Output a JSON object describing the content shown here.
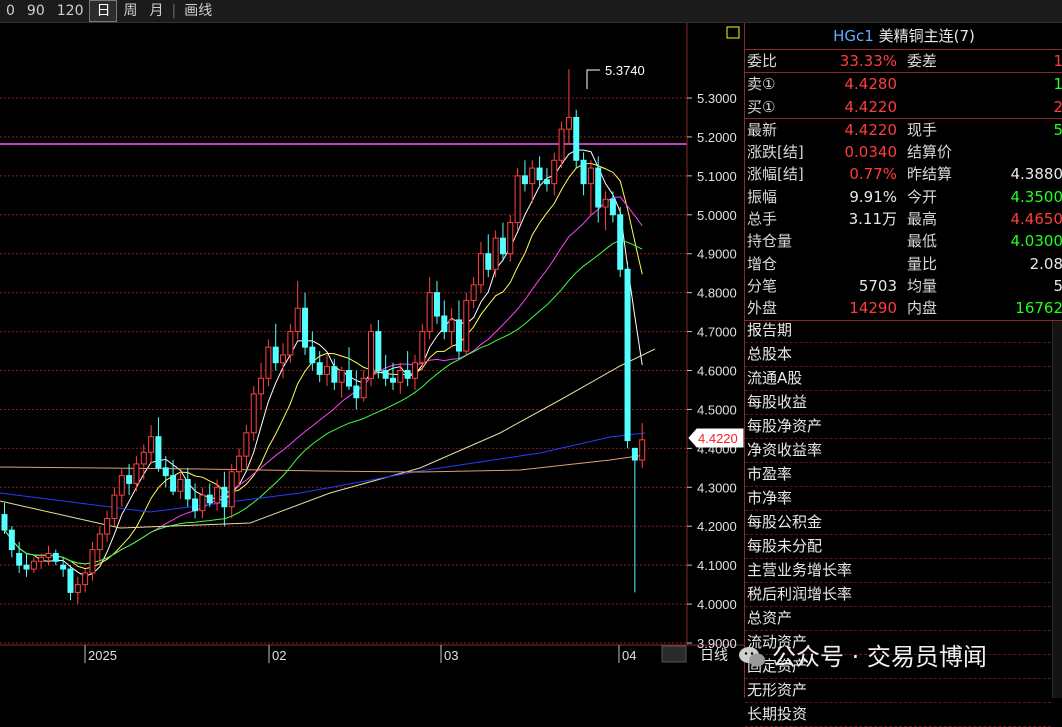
{
  "toolbar": {
    "items": [
      "0",
      "90",
      "120",
      "日",
      "周",
      "月",
      "画线"
    ],
    "active": "日"
  },
  "chart": {
    "price_labels": [
      "5.3000",
      "5.2000",
      "5.1000",
      "5.0000",
      "4.9000",
      "4.8000",
      "4.7000",
      "4.6000",
      "4.5000",
      "4.4000",
      "4.3000",
      "4.2000",
      "4.1000",
      "4.0000",
      "3.9000"
    ],
    "date_labels": [
      "2025",
      "02",
      "03",
      "04"
    ],
    "high_annotation": "5.3740",
    "current_price": "4.4220",
    "period_tab": "日线",
    "colors": {
      "up": "#ff4040",
      "down": "#54ffff",
      "ma5": "#ffffff",
      "ma10": "#ffff55",
      "ma20": "#ff40ff",
      "ma30": "#40ff40",
      "ma60": "#e0e0a0",
      "ma120": "#2a3aff",
      "ma250": "#e0a070",
      "grid": "#8a1a1a",
      "hline": "#ff55ff"
    }
  },
  "panel": {
    "code": "HGc1",
    "name": "美精铜主连(7)",
    "rows1": [
      {
        "l": "委比",
        "v": "33.33%",
        "vc": "red",
        "l2": "委差",
        "v2": "1",
        "v2c": "red"
      }
    ],
    "rows2": [
      {
        "l": "卖①",
        "v": "4.4280",
        "vc": "red",
        "l2": "",
        "v2": "1",
        "v2c": "green"
      },
      {
        "l": "买①",
        "v": "4.4220",
        "vc": "red",
        "l2": "",
        "v2": "2",
        "v2c": "red"
      }
    ],
    "rows3": [
      {
        "l": "最新",
        "v": "4.4220",
        "vc": "red",
        "l2": "现手",
        "v2": "5",
        "v2c": "green"
      },
      {
        "l": "涨跌[结]",
        "v": "0.0340",
        "vc": "red",
        "l2": "结算价",
        "v2": "",
        "v2c": "white"
      },
      {
        "l": "涨幅[结]",
        "v": "0.77%",
        "vc": "red",
        "l2": "昨结算",
        "v2": "4.3880",
        "v2c": "white"
      },
      {
        "l": "振幅",
        "v": "9.91%",
        "vc": "white",
        "l2": "今开",
        "v2": "4.3500",
        "v2c": "green"
      },
      {
        "l": "总手",
        "v": "3.11万",
        "vc": "white",
        "l2": "最高",
        "v2": "4.4650",
        "v2c": "red"
      },
      {
        "l": "持仓量",
        "v": "",
        "vc": "white",
        "l2": "最低",
        "v2": "4.0300",
        "v2c": "green"
      },
      {
        "l": "增仓",
        "v": "",
        "vc": "white",
        "l2": "量比",
        "v2": "2.08",
        "v2c": "white"
      },
      {
        "l": "分笔",
        "v": "5703",
        "vc": "white",
        "l2": "均量",
        "v2": "5",
        "v2c": "white"
      },
      {
        "l": "外盘",
        "v": "14290",
        "vc": "red",
        "l2": "内盘",
        "v2": "16762",
        "v2c": "green"
      }
    ],
    "fundamentals": [
      "报告期",
      "总股本",
      "流通A股",
      "每股收益",
      "每股净资产",
      "净资收益率",
      "市盈率",
      "市净率",
      "每股公积金",
      "每股未分配",
      "主营业务增长率",
      "税后利润增长率",
      "总资产",
      "流动资产",
      "固定资产",
      "无形资产",
      "长期投资"
    ]
  },
  "watermark": "公众号 · 交易员博闻"
}
